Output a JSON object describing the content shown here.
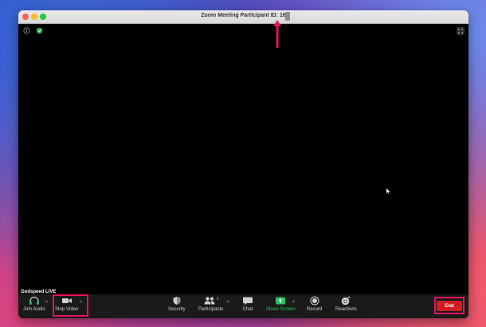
{
  "window": {
    "title": "Zoom Meeting Participant ID: 16"
  },
  "video": {
    "participant_name": "Godspeed LIVE"
  },
  "toolbar": {
    "join_audio": "Join Audio",
    "stop_video": "Stop Video",
    "security": "Security",
    "participants": "Participants",
    "participants_count": "1",
    "chat": "Chat",
    "share_screen": "Share Screen",
    "record": "Record",
    "reactions": "Reactions",
    "end": "End"
  },
  "colors": {
    "highlight": "#e8115f",
    "share_green": "#22c35d",
    "end_red": "#d11c24"
  }
}
